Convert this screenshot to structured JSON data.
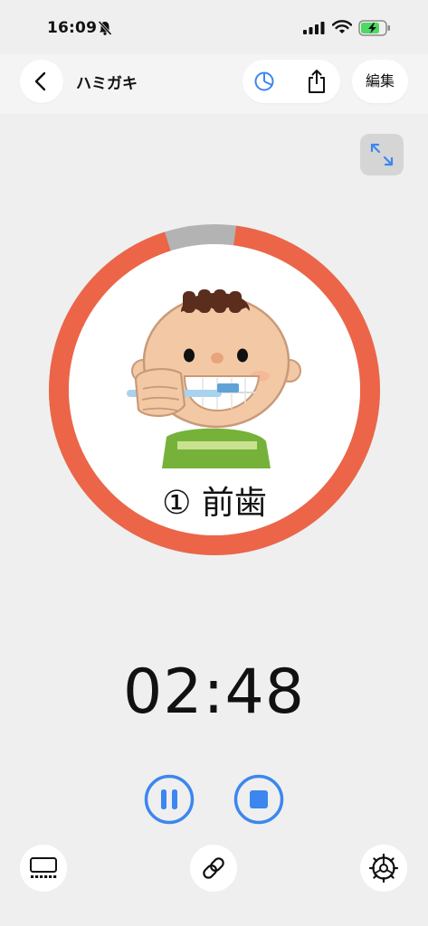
{
  "status_bar": {
    "time": "16:09"
  },
  "nav": {
    "title": "ハミガキ",
    "edit_label": "編集"
  },
  "timer": {
    "step_label": "① 前歯",
    "time_display": "02:48",
    "remaining_fraction": 0.93
  },
  "colors": {
    "accent": "#3c86ef",
    "ring": "#ec6548",
    "ring_track": "#b3b3b3",
    "background": "#efefef"
  }
}
